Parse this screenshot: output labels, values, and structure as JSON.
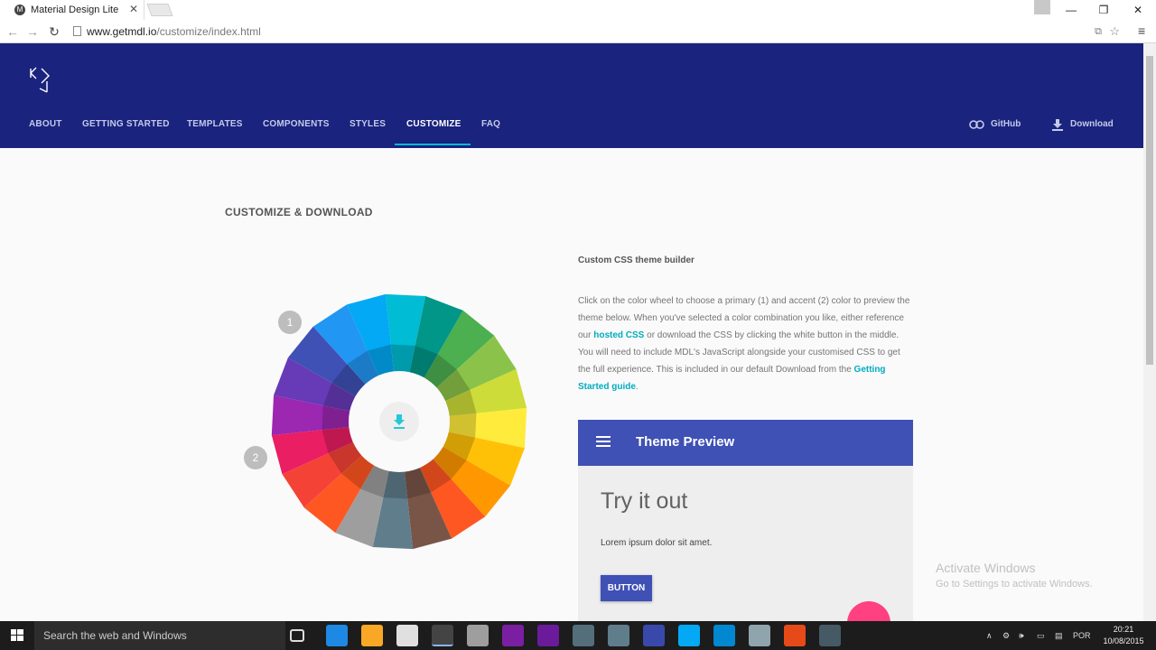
{
  "browser": {
    "tab_title": "Material Design Lite",
    "tab_close_icon": "close-icon",
    "url_host": "www.getmdl.io",
    "url_path": "/customize/index.html"
  },
  "header": {
    "nav": [
      "ABOUT",
      "GETTING STARTED",
      "TEMPLATES",
      "COMPONENTS",
      "STYLES",
      "CUSTOMIZE",
      "FAQ"
    ],
    "active_nav": "CUSTOMIZE",
    "github_label": "GitHub",
    "download_label": "Download"
  },
  "main": {
    "section_title": "CUSTOMIZE & DOWNLOAD",
    "builder_title": "Custom CSS theme builder",
    "desc_1": "Click on the color wheel to choose a primary (1) and accent (2) color to preview the theme below. When you've selected a color combination you like, either reference our ",
    "desc_link_1": "hosted CSS",
    "desc_2": " or download the CSS by clicking the white button in the middle. You will need to include MDL's JavaScript alongside your customised CSS to get the full experience. This is included in our default Download from the ",
    "desc_link_2": "Getting Started guide",
    "desc_3": ".",
    "marker_primary": "1",
    "marker_accent": "2"
  },
  "preview": {
    "title": "Theme Preview",
    "heading": "Try it out",
    "text": "Lorem ipsum dolor sit amet.",
    "button": "BUTTON"
  },
  "watermark": {
    "title": "Activate Windows",
    "subtitle": "Go to Settings to activate Windows."
  },
  "taskbar": {
    "search_placeholder": "Search the web and Windows",
    "lang": "POR",
    "time": "20:21",
    "date": "10/08/2015"
  },
  "colors": {
    "header": "#1a237e",
    "accent_underline": "#00bcd4",
    "preview_primary": "#3f51b5",
    "preview_accent": "#ff4081"
  }
}
